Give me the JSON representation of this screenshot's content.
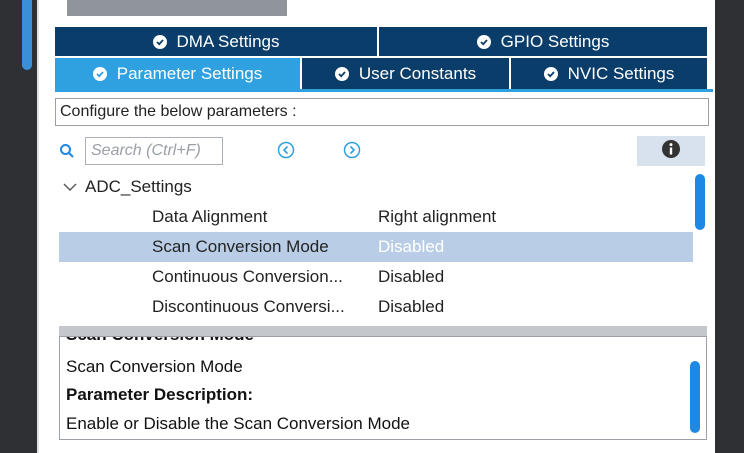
{
  "tabs": {
    "row1": [
      {
        "label": "DMA Settings"
      },
      {
        "label": "GPIO Settings"
      }
    ],
    "row2": [
      {
        "label": "Parameter Settings"
      },
      {
        "label": "User Constants"
      },
      {
        "label": "NVIC Settings"
      }
    ]
  },
  "config_prompt": "Configure the below parameters :",
  "search": {
    "placeholder": "Search (Ctrl+F)"
  },
  "tree": {
    "group": "ADC_Settings",
    "rows": [
      {
        "name": "Data Alignment",
        "value": "Right alignment"
      },
      {
        "name": "Scan Conversion Mode",
        "value": "Disabled"
      },
      {
        "name": "Continuous Conversion...",
        "value": "Disabled"
      },
      {
        "name": "Discontinuous Conversi...",
        "value": "Disabled"
      }
    ]
  },
  "description": {
    "clipped_title": "Scan Conversion Mode",
    "title": "Scan Conversion Mode",
    "param_heading": "Parameter Description:",
    "text": "Enable or Disable the Scan Conversion Mode"
  },
  "colors": {
    "tab_dark": "#0b3d6b",
    "tab_active": "#30a1e0",
    "selection": "#b9cee6",
    "scroll_thumb": "#1e88e5"
  },
  "icons": [
    "check-circle-icon",
    "search-icon",
    "chevron-left-icon",
    "chevron-right-icon",
    "info-icon",
    "chevron-down-icon"
  ]
}
